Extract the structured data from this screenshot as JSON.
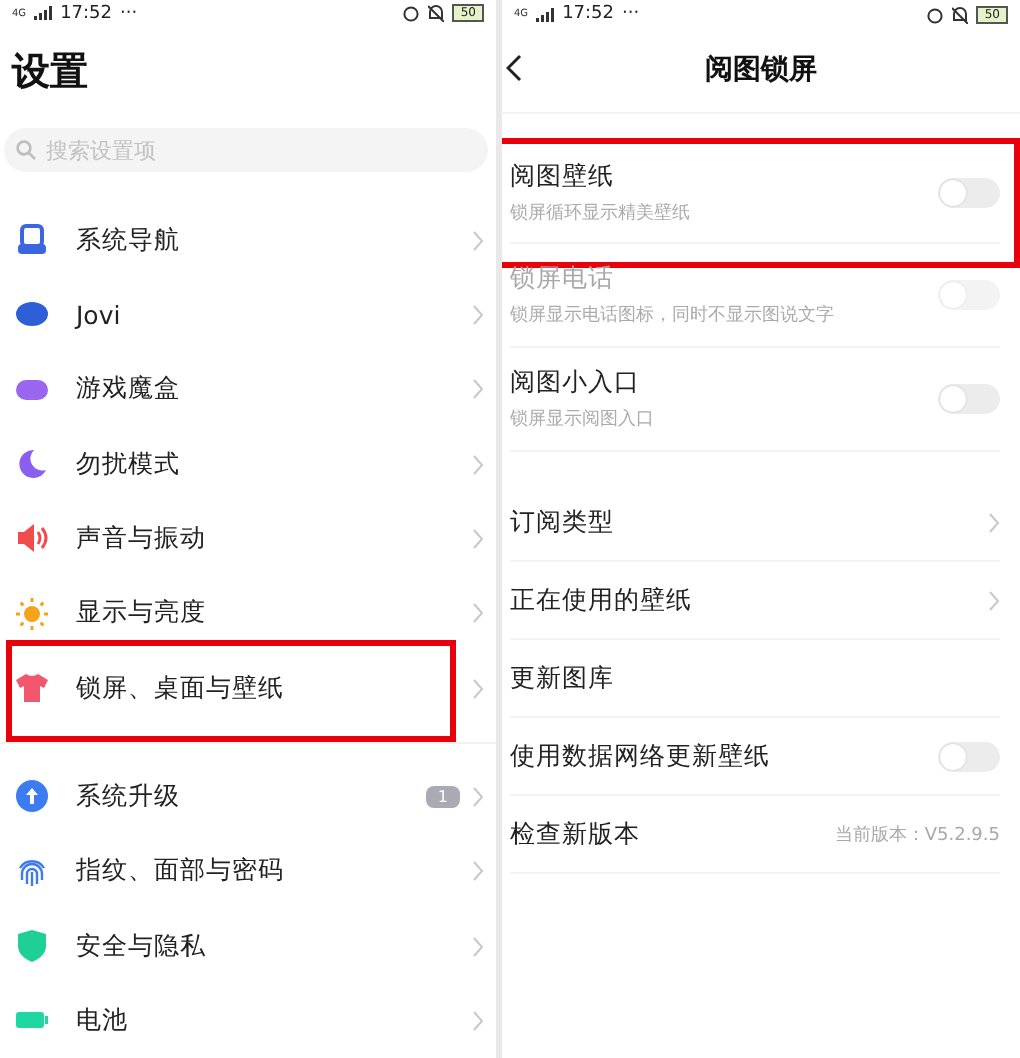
{
  "screens": [
    {
      "status_bar": {
        "network": "4G",
        "time": "17:52",
        "dots": "···",
        "battery": "50"
      },
      "title": "设置",
      "search": {
        "placeholder": "搜索设置项"
      },
      "groups": [
        [
          {
            "label": "系统导航",
            "highlighted": false
          },
          {
            "label": "Jovi",
            "highlighted": false
          },
          {
            "label": "游戏魔盒",
            "highlighted": false
          },
          {
            "label": "勿扰模式",
            "highlighted": false
          },
          {
            "label": "声音与振动",
            "highlighted": false
          },
          {
            "label": "显示与亮度",
            "highlighted": false
          },
          {
            "label": "锁屏、桌面与壁纸",
            "highlighted": true
          }
        ],
        [
          {
            "label": "系统升级",
            "badge": "1",
            "highlighted": false
          },
          {
            "label": "指纹、面部与密码",
            "highlighted": false
          },
          {
            "label": "安全与隐私",
            "highlighted": false
          },
          {
            "label": "电池",
            "highlighted": false
          }
        ]
      ]
    },
    {
      "status_bar": {
        "network": "4G",
        "time": "17:52",
        "dots": "···",
        "battery": "50"
      },
      "title": "阅图锁屏",
      "groups": [
        [
          {
            "kind": "toggle",
            "label": "阅图壁纸",
            "subtitle": "锁屏循环显示精美壁纸",
            "on": false,
            "disabled": false,
            "highlighted": true
          },
          {
            "kind": "toggle",
            "label": "锁屏电话",
            "subtitle": "锁屏显示电话图标，同时不显示图说文字",
            "on": false,
            "disabled": true,
            "highlighted": false
          },
          {
            "kind": "toggle",
            "label": "阅图小入口",
            "subtitle": "锁屏显示阅图入口",
            "on": false,
            "disabled": false,
            "highlighted": false
          }
        ],
        [
          {
            "kind": "link",
            "label": "订阅类型"
          },
          {
            "kind": "link",
            "label": "正在使用的壁纸"
          },
          {
            "kind": "plain",
            "label": "更新图库"
          },
          {
            "kind": "toggle",
            "label": "使用数据网络更新壁纸",
            "on": false,
            "disabled": false,
            "highlighted": false
          },
          {
            "kind": "value",
            "label": "检查新版本",
            "value": "当前版本：V5.2.9.5"
          }
        ]
      ]
    }
  ]
}
